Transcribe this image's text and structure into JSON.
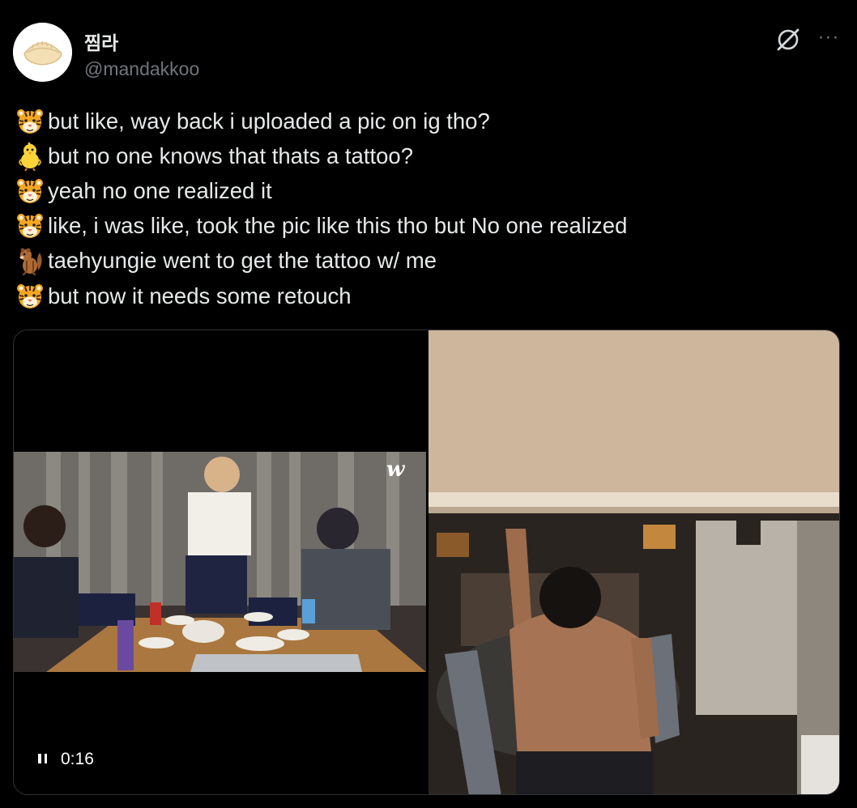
{
  "author": {
    "display_name": "찜라",
    "handle": "@mandakkoo",
    "avatar_icon": "dumpling-emoji-avatar"
  },
  "header_actions": {
    "grok_icon": "grok-icon",
    "more_icon": "more-options-icon",
    "more_label": "···"
  },
  "tweet": {
    "lines": [
      {
        "emoji_icon": "tiger-emoji",
        "text": "but like, way back i uploaded a pic on ig tho?"
      },
      {
        "emoji_icon": "chick-emoji",
        "text": "but no one knows that thats a tattoo?"
      },
      {
        "emoji_icon": "tiger-emoji",
        "text": "yeah no one realized it"
      },
      {
        "emoji_icon": "tiger-emoji",
        "text": "like, i was like, took the pic like this tho but No one realized"
      },
      {
        "emoji_icon": "chipmunk-emoji",
        "text": "taehyungie went to get the tattoo w/ me"
      },
      {
        "emoji_icon": "tiger-emoji",
        "text": "but now it needs some retouch"
      }
    ]
  },
  "media": {
    "video": {
      "time": "0:16",
      "watermark": "w",
      "state": "playing"
    },
    "photo": {
      "description_icon": "photo"
    }
  }
}
